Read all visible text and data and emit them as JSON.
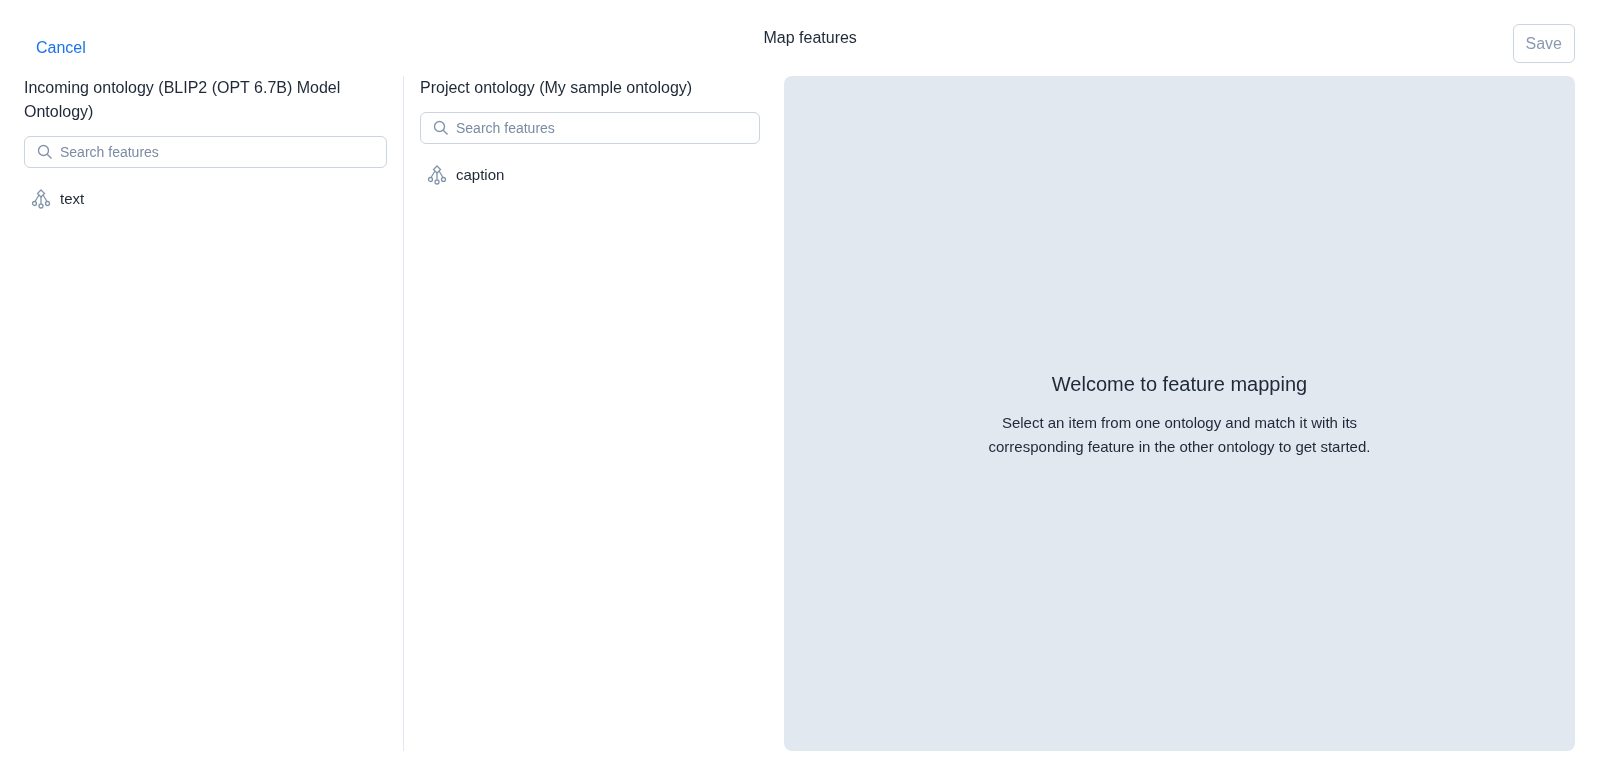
{
  "header": {
    "cancel": "Cancel",
    "title": "Map features",
    "save": {
      "label": "Save",
      "disabled": true
    }
  },
  "incoming": {
    "title": "Incoming ontology (BLIP2 (OPT 6.7B) Model Ontology)",
    "search": {
      "placeholder": "Search features"
    },
    "items": [
      {
        "label": "text"
      }
    ]
  },
  "project": {
    "title": "Project ontology (My sample ontology)",
    "search": {
      "placeholder": "Search features"
    },
    "items": [
      {
        "label": "caption"
      }
    ]
  },
  "welcome": {
    "title": "Welcome to feature mapping",
    "text": "Select an item from one ontology and match it with its corresponding feature in the other ontology to get started."
  }
}
